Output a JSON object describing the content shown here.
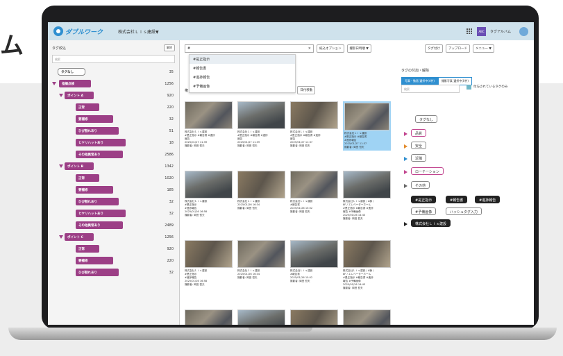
{
  "hero_mark": "ム",
  "app": {
    "logo_text": "ダブルワーク",
    "company": "株式会社Ｌｉｓ建設▼",
    "team_avatar": "ABC",
    "team_name": "タグアルバム"
  },
  "left_panel": {
    "title": "タグ絞込",
    "clear_label": "解除",
    "search_placeholder": "検索",
    "tags": [
      {
        "label": "タグなし",
        "count": "35"
      },
      {
        "label": "指摘点検",
        "count": "1256"
      },
      {
        "label": "ポイント A",
        "count": "920"
      },
      {
        "label": "正常",
        "count": "220"
      },
      {
        "label": "要補修",
        "count": "32"
      },
      {
        "label": "ひび割れあり",
        "count": "51"
      },
      {
        "label": "ヒヤリハットあり",
        "count": "18"
      },
      {
        "label": "その他異常あり",
        "count": "2586"
      },
      {
        "label": "ポイント B",
        "count": "1342"
      },
      {
        "label": "正常",
        "count": "1020"
      },
      {
        "label": "要補修",
        "count": "185"
      },
      {
        "label": "ひび割れあり",
        "count": "32"
      },
      {
        "label": "ヒヤリハットあり",
        "count": "32"
      },
      {
        "label": "その他異常あり",
        "count": "2489"
      },
      {
        "label": "ポイント C",
        "count": "1256"
      },
      {
        "label": "正常",
        "count": "920"
      },
      {
        "label": "要補修",
        "count": "220"
      },
      {
        "label": "ひび割れあり",
        "count": "32"
      }
    ]
  },
  "center": {
    "search_value": "#",
    "clear_x": "×",
    "filter_options": "絞込オプション",
    "sort": "撮影日時順 ▼",
    "dropdown": [
      "#是正指示",
      "#報告書",
      "#進捗報告",
      "#予備画像"
    ],
    "sub_prefix": "権",
    "sub_num": "7",
    "date_move": "日付移動",
    "photos": [
      {
        "meta": [
          "株式会社Ｌｉｓ建設",
          "#是正指示 #報告書 #進捗",
          "報告",
          "2025/01/27 11:39",
          "撮影者: 岡田 哲夫"
        ],
        "variant": "a"
      },
      {
        "meta": [
          "株式会社Ｌｉｓ建設",
          "#是正指示 #報告書 #進捗",
          "報告",
          "2025/01/27 11:39",
          "撮影者: 岡田 哲夫"
        ],
        "variant": "b"
      },
      {
        "meta": [
          "株式会社Ｌｉｓ建設",
          "#是正指示 #報告書 #進捗",
          "報告",
          "2025/01/27 11:37",
          "撮影者: 岡田 哲夫"
        ],
        "variant": "c"
      },
      {
        "meta": [
          "株式会社Ｌｉｓ建設",
          "#是正指示 #報告書",
          "#進捗報告",
          "2025/01/27 11:37",
          "撮影者: 岡田 哲夫"
        ],
        "variant": "a",
        "selected": true
      },
      {
        "meta": [
          "株式会社Ｌｉｓ建設",
          "#是正指示",
          "#進捗報告",
          "2025/01/26 16:58",
          "撮影者: 岡田 哲夫"
        ],
        "variant": "b"
      },
      {
        "meta": [
          "株式会社Ｌｉｓ建設",
          "2025/01/26 16:34",
          "撮影者: 岡田 哲夫"
        ],
        "variant": "c"
      },
      {
        "meta": [
          "株式会社Ｌｉｓ建設",
          "#報告書",
          "2025/01/26 15:02",
          "撮影者: 岡田 哲夫"
        ],
        "variant": "a"
      },
      {
        "meta": [
          "株式会社Ｌｉｓ建設 / A棟 /",
          "8F / エレベーターホール",
          "#是正指示 #報告書 #進捗",
          "報告 #予備画像",
          "2025/01/26 14:43",
          "撮影者: 岡田 哲夫"
        ],
        "variant": "b"
      },
      {
        "meta": [
          "株式会社Ｌｉｓ建設",
          "#是正指示",
          "#進捗報告",
          "2025/01/26 16:58",
          "撮影者: 岡田 哲夫"
        ],
        "variant": "c"
      },
      {
        "meta": [
          "株式会社Ｌｉｓ建設",
          "2025/01/26 16:34",
          "撮影者: 岡田 哲夫"
        ],
        "variant": "a"
      },
      {
        "meta": [
          "株式会社Ｌｉｓ建設",
          "#報告書",
          "2025/01/26 15:02",
          "撮影者: 岡田 哲夫"
        ],
        "variant": "b"
      },
      {
        "meta": [
          "株式会社Ｌｉｓ建設 / A棟 /",
          "8F / エレベーターホール",
          "#是正指示 #報告書 #進捗",
          "報告 #予備画像",
          "2025/01/26 14:43",
          "撮影者: 岡田 哲夫"
        ],
        "variant": "c"
      },
      {
        "meta": [],
        "variant": "a"
      },
      {
        "meta": [],
        "variant": "b"
      },
      {
        "meta": [],
        "variant": "c"
      },
      {
        "meta": [],
        "variant": "a"
      }
    ]
  },
  "right_panel": {
    "tag_btn": "タグ付け",
    "upload_btn": "アップロード",
    "menu_btn": "メニュー ▼",
    "title": "タグの付加・解除",
    "tab_on": "写真・動画 選択中(4件)",
    "tab_off": "撮影写真 選択中(0件)",
    "search_placeholder": "検索",
    "check_label": "付与されているタグのみ",
    "tags": [
      "タグなし",
      "品質",
      "安全",
      "近隣",
      "ローテーション",
      "その他"
    ],
    "hashtags": [
      "#是正指示",
      "#報告書",
      "#進捗報告",
      "#予備画像"
    ],
    "hashtag_input": "ハッシュタグ入力",
    "company_tag": "株式会社Ｌｉｓ建設"
  }
}
